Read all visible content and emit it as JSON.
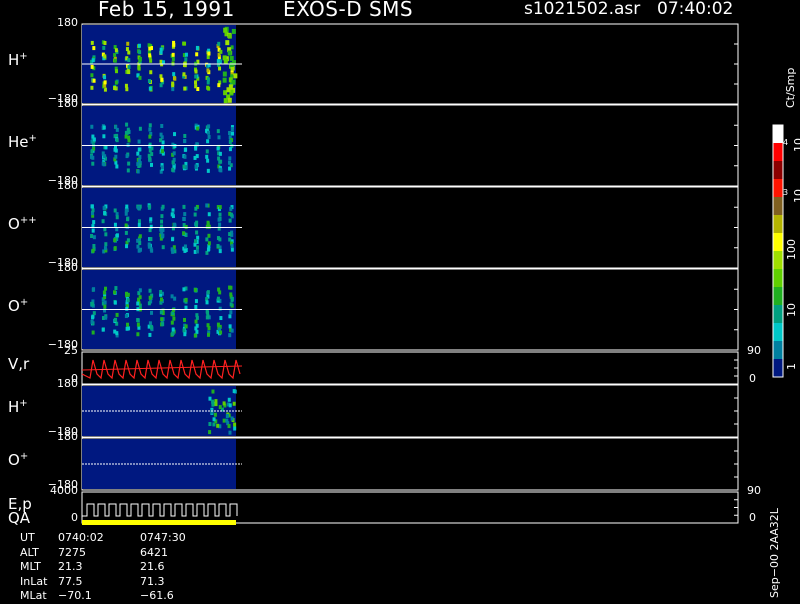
{
  "header": {
    "date": "Feb 15, 1991",
    "instrument": "EXOS-D SMS",
    "file": "s1021502.asr",
    "time": "07:40:02"
  },
  "panels": [
    {
      "label": "H",
      "sup": "+",
      "ymax": "180",
      "ymin": "−180"
    },
    {
      "label": "He",
      "sup": "+",
      "ymax": "180",
      "ymin": "−180"
    },
    {
      "label": "O",
      "sup": "++",
      "ymax": "180",
      "ymin": "−180"
    },
    {
      "label": "O",
      "sup": "+",
      "ymax": "180",
      "ymin": "−180"
    },
    {
      "label": "V,r",
      "sup": "",
      "ymax": "25",
      "ymin": "0",
      "rmax": "90",
      "rmin": "0"
    },
    {
      "label": "H",
      "sup": "+",
      "ymax": "180",
      "ymin": "−180"
    },
    {
      "label": "O",
      "sup": "+",
      "ymax": "180",
      "ymin": "−180"
    },
    {
      "label": "E,p",
      "sup": "",
      "ymax": "4000",
      "ymin": "0",
      "rmax": "90",
      "rmin": "0"
    }
  ],
  "qa_label": "QA",
  "colorbar": {
    "unit": "Ct/Smp",
    "labels": [
      "10",
      "4",
      "10",
      "3",
      "100",
      "10",
      "1"
    ],
    "colors": [
      "#ffffff",
      "#ff0000",
      "#8b0000",
      "#ff1400",
      "#806020",
      "#b4b400",
      "#ffff00",
      "#a0e000",
      "#60d000",
      "#20b020",
      "#00a080",
      "#00c8c8",
      "#0080a0",
      "#001880"
    ]
  },
  "info": {
    "rows": [
      "UT",
      "ALT",
      "MLT",
      "InLat",
      "MLat"
    ],
    "col1": [
      "0740:02",
      "7275",
      "21.3",
      "77.5",
      "−70.1"
    ],
    "col2": [
      "0747:30",
      "6421",
      "21.6",
      "71.3",
      "−61.6"
    ]
  },
  "footer_id": "Sep−00  2AA32L",
  "chart_data": {
    "type": "heatmap",
    "title": "Feb 15, 1991   EXOS-D SMS",
    "time_range": [
      "0740:02",
      "0747:30"
    ],
    "ion_panels": [
      "H+",
      "He+",
      "O++",
      "O+",
      "H+",
      "O+"
    ],
    "pitch_angle_range": [
      -180,
      180
    ],
    "velocity_range": [
      0,
      25
    ],
    "energy_range": [
      0,
      4000
    ],
    "angle_range": [
      0,
      90
    ],
    "colorbar_range": [
      1,
      10000
    ],
    "colorbar_scale": "log",
    "colorbar_unit": "Ct/Smp"
  }
}
